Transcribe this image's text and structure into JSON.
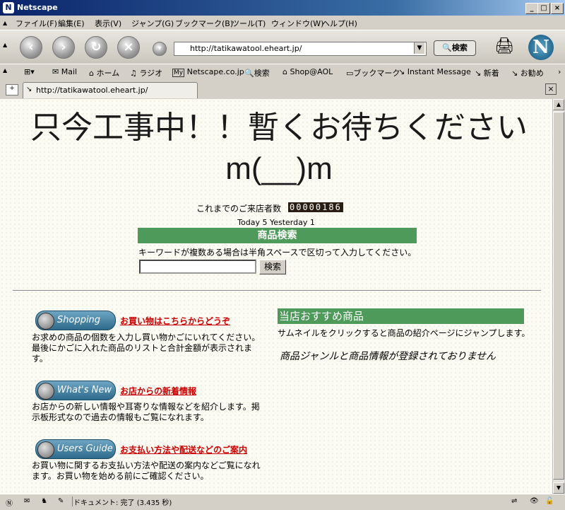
{
  "window": {
    "title": "Netscape"
  },
  "menu": [
    "ファイル(F)",
    "編集(E)",
    "表示(V)",
    "ジャンプ(G)",
    "ブックマーク(B)",
    "ツール(T)",
    "ウィンドウ(W)",
    "ヘルプ(H)"
  ],
  "nav": {
    "url": "http://tatikawatool.eheart.jp/",
    "search_label": "検索"
  },
  "personal_bar": [
    "Mail",
    "ホーム",
    "ラジオ",
    "Netscape.co.jp",
    "検索",
    "Shop@AOL",
    "ブックマーク",
    "Instant Message",
    "新着",
    "お勧め"
  ],
  "tab": {
    "title": "http://tatikawatool.eheart.jp/"
  },
  "page": {
    "heading_line1": "只今工事中！！暫くお待ちください",
    "heading_line2": "m(__)m",
    "visitor_label": "これまでのご来店者数",
    "visitor_count": "00000186",
    "today_line": "Today 5 Yesterday 1",
    "search": {
      "header": "商品検索",
      "hint": "キーワードが複数ある場合は半角スペースで区切って入力してください。",
      "button": "検索",
      "value": ""
    },
    "sections": [
      {
        "pill": "Shopping",
        "link": "お買い物はこちらからどうぞ",
        "desc": "お求めの商品の個数を入力し買い物かごにいれてください。最後にかごに入れた商品のリストと合計金額が表示されます。"
      },
      {
        "pill": "What's New",
        "link": "お店からの新着情報",
        "desc": "お店からの新しい情報や耳寄りな情報などを紹介します。掲示板形式なので過去の情報もご覧になれます。"
      },
      {
        "pill": "Users Guide",
        "link": "お支払い方法や配送などのご案内",
        "desc": "お買い物に関するお支払い方法や配送の案内などご覧になれます。お買い物を始める前にご確認ください。"
      }
    ],
    "recommend": {
      "header": "当店おすすめ商品",
      "desc": "サムネイルをクリックすると商品の紹介ページにジャンプします。",
      "note": "商品ジャンルと商品情報が登録されておりません"
    }
  },
  "status": {
    "text": "ドキュメント: 完了 (3.435 秒)"
  },
  "colors": {
    "section_green": "#4e9a5a",
    "link_red": "#cc0000",
    "counter_bg": "#2a1d14",
    "titlebar": "#0a246a"
  }
}
